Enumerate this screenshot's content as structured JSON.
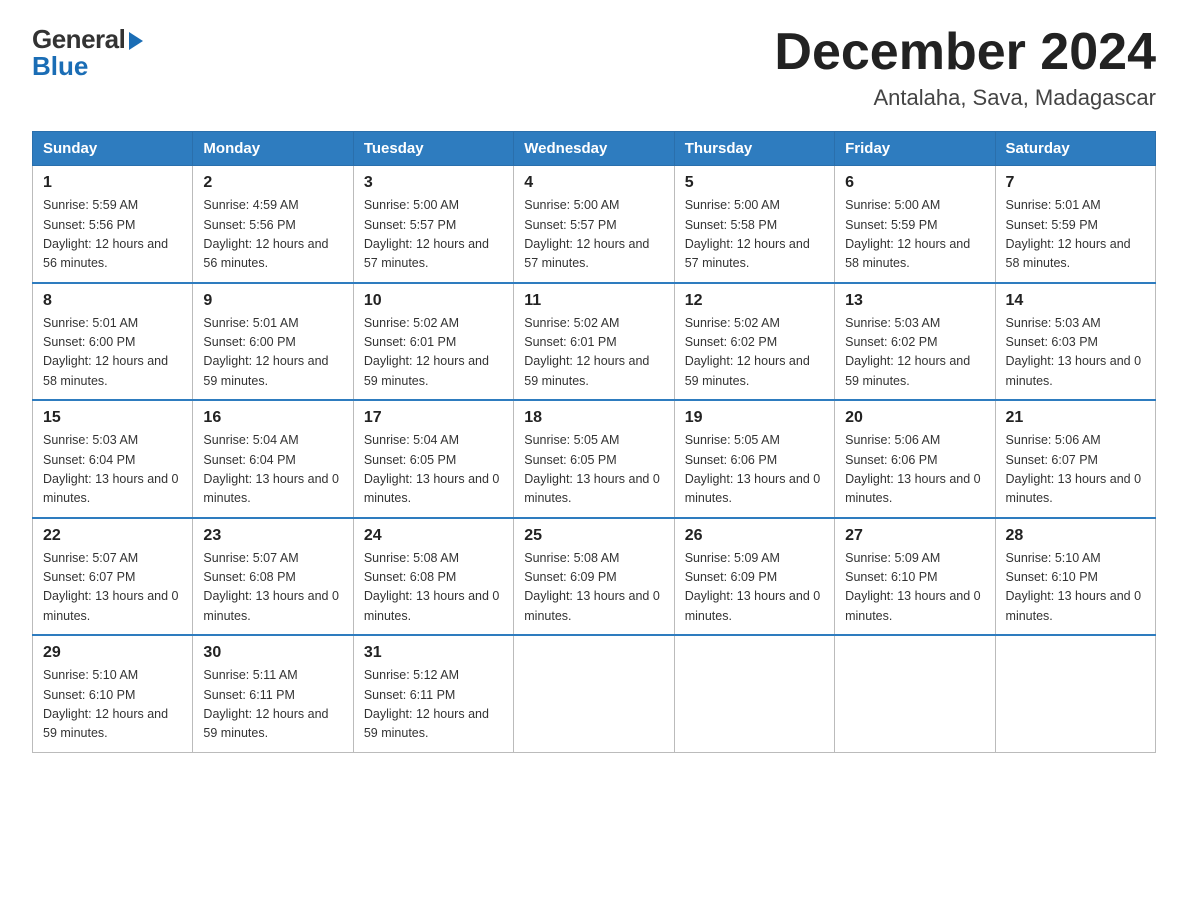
{
  "logo": {
    "general": "General",
    "blue": "Blue"
  },
  "header": {
    "title": "December 2024",
    "location": "Antalaha, Sava, Madagascar"
  },
  "days_of_week": [
    "Sunday",
    "Monday",
    "Tuesday",
    "Wednesday",
    "Thursday",
    "Friday",
    "Saturday"
  ],
  "weeks": [
    [
      {
        "day": "1",
        "sunrise": "5:59 AM",
        "sunset": "5:56 PM",
        "daylight": "12 hours and 56 minutes."
      },
      {
        "day": "2",
        "sunrise": "4:59 AM",
        "sunset": "5:56 PM",
        "daylight": "12 hours and 56 minutes."
      },
      {
        "day": "3",
        "sunrise": "5:00 AM",
        "sunset": "5:57 PM",
        "daylight": "12 hours and 57 minutes."
      },
      {
        "day": "4",
        "sunrise": "5:00 AM",
        "sunset": "5:57 PM",
        "daylight": "12 hours and 57 minutes."
      },
      {
        "day": "5",
        "sunrise": "5:00 AM",
        "sunset": "5:58 PM",
        "daylight": "12 hours and 57 minutes."
      },
      {
        "day": "6",
        "sunrise": "5:00 AM",
        "sunset": "5:59 PM",
        "daylight": "12 hours and 58 minutes."
      },
      {
        "day": "7",
        "sunrise": "5:01 AM",
        "sunset": "5:59 PM",
        "daylight": "12 hours and 58 minutes."
      }
    ],
    [
      {
        "day": "8",
        "sunrise": "5:01 AM",
        "sunset": "6:00 PM",
        "daylight": "12 hours and 58 minutes."
      },
      {
        "day": "9",
        "sunrise": "5:01 AM",
        "sunset": "6:00 PM",
        "daylight": "12 hours and 59 minutes."
      },
      {
        "day": "10",
        "sunrise": "5:02 AM",
        "sunset": "6:01 PM",
        "daylight": "12 hours and 59 minutes."
      },
      {
        "day": "11",
        "sunrise": "5:02 AM",
        "sunset": "6:01 PM",
        "daylight": "12 hours and 59 minutes."
      },
      {
        "day": "12",
        "sunrise": "5:02 AM",
        "sunset": "6:02 PM",
        "daylight": "12 hours and 59 minutes."
      },
      {
        "day": "13",
        "sunrise": "5:03 AM",
        "sunset": "6:02 PM",
        "daylight": "12 hours and 59 minutes."
      },
      {
        "day": "14",
        "sunrise": "5:03 AM",
        "sunset": "6:03 PM",
        "daylight": "13 hours and 0 minutes."
      }
    ],
    [
      {
        "day": "15",
        "sunrise": "5:03 AM",
        "sunset": "6:04 PM",
        "daylight": "13 hours and 0 minutes."
      },
      {
        "day": "16",
        "sunrise": "5:04 AM",
        "sunset": "6:04 PM",
        "daylight": "13 hours and 0 minutes."
      },
      {
        "day": "17",
        "sunrise": "5:04 AM",
        "sunset": "6:05 PM",
        "daylight": "13 hours and 0 minutes."
      },
      {
        "day": "18",
        "sunrise": "5:05 AM",
        "sunset": "6:05 PM",
        "daylight": "13 hours and 0 minutes."
      },
      {
        "day": "19",
        "sunrise": "5:05 AM",
        "sunset": "6:06 PM",
        "daylight": "13 hours and 0 minutes."
      },
      {
        "day": "20",
        "sunrise": "5:06 AM",
        "sunset": "6:06 PM",
        "daylight": "13 hours and 0 minutes."
      },
      {
        "day": "21",
        "sunrise": "5:06 AM",
        "sunset": "6:07 PM",
        "daylight": "13 hours and 0 minutes."
      }
    ],
    [
      {
        "day": "22",
        "sunrise": "5:07 AM",
        "sunset": "6:07 PM",
        "daylight": "13 hours and 0 minutes."
      },
      {
        "day": "23",
        "sunrise": "5:07 AM",
        "sunset": "6:08 PM",
        "daylight": "13 hours and 0 minutes."
      },
      {
        "day": "24",
        "sunrise": "5:08 AM",
        "sunset": "6:08 PM",
        "daylight": "13 hours and 0 minutes."
      },
      {
        "day": "25",
        "sunrise": "5:08 AM",
        "sunset": "6:09 PM",
        "daylight": "13 hours and 0 minutes."
      },
      {
        "day": "26",
        "sunrise": "5:09 AM",
        "sunset": "6:09 PM",
        "daylight": "13 hours and 0 minutes."
      },
      {
        "day": "27",
        "sunrise": "5:09 AM",
        "sunset": "6:10 PM",
        "daylight": "13 hours and 0 minutes."
      },
      {
        "day": "28",
        "sunrise": "5:10 AM",
        "sunset": "6:10 PM",
        "daylight": "13 hours and 0 minutes."
      }
    ],
    [
      {
        "day": "29",
        "sunrise": "5:10 AM",
        "sunset": "6:10 PM",
        "daylight": "12 hours and 59 minutes."
      },
      {
        "day": "30",
        "sunrise": "5:11 AM",
        "sunset": "6:11 PM",
        "daylight": "12 hours and 59 minutes."
      },
      {
        "day": "31",
        "sunrise": "5:12 AM",
        "sunset": "6:11 PM",
        "daylight": "12 hours and 59 minutes."
      },
      null,
      null,
      null,
      null
    ]
  ]
}
